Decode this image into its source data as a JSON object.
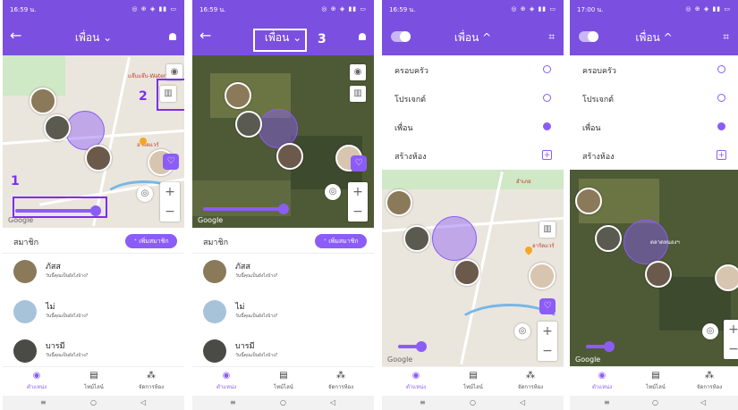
{
  "screens": [
    {
      "status_time": "16:59 น.",
      "status_icons": "◎ ⊕ ◈ ▮▮ ▭",
      "title": "เพื่อน ⌄",
      "members_header": "สมาชิก",
      "add_member_label": "⁺ เพิ่มสมาชิก",
      "google_label": "Google",
      "map_label_1": "แจ๊บแจ๊บ-Water",
      "map_label_2": "ฮาร์ดแวร์",
      "annotation_1": "1",
      "annotation_2": "2",
      "members": [
        {
          "name": "ภัสส",
          "sub": "วันนี้คุณเป็นยังไงบ้าง?"
        },
        {
          "name": "ไม่",
          "sub": "วันนี้คุณเป็นยังไงบ้าง?"
        },
        {
          "name": "บารมี",
          "sub": "วันนี้คุณเป็นยังไงบ้าง?"
        }
      ],
      "nav": [
        {
          "label": "ตำแหน่ง",
          "icon": "location-pin-icon",
          "active": true
        },
        {
          "label": "ไทม์ไลน์",
          "icon": "timeline-icon",
          "active": false
        },
        {
          "label": "จัดการห้อง",
          "icon": "group-icon",
          "active": false
        }
      ]
    },
    {
      "status_time": "16:59 น.",
      "status_icons": "◎ ⊕ ◈ ▮▮ ▭",
      "title": "เพื่อน ⌄",
      "members_header": "สมาชิก",
      "add_member_label": "⁺ เพิ่มสมาชิก",
      "google_label": "Google",
      "annotation_3": "3",
      "members": [
        {
          "name": "ภัสส",
          "sub": "วันนี้คุณเป็นยังไงบ้าง?"
        },
        {
          "name": "ไม่",
          "sub": "วันนี้คุณเป็นยังไงบ้าง?"
        },
        {
          "name": "บารมี",
          "sub": "วันนี้คุณเป็นยังไงบ้าง?"
        }
      ],
      "nav": [
        {
          "label": "ตำแหน่ง",
          "icon": "location-pin-icon",
          "active": true
        },
        {
          "label": "ไทม์ไลน์",
          "icon": "timeline-icon",
          "active": false
        },
        {
          "label": "จัดการห้อง",
          "icon": "group-icon",
          "active": false
        }
      ]
    },
    {
      "status_time": "16:59 น.",
      "status_icons": "◎ ⊕ ◈ ▮▮ ▭",
      "title": "เพื่อน ^",
      "google_label": "Google",
      "map_label_1": "ฮาร์ดแวร์",
      "map_label_2": "อำเภอ",
      "menu": [
        {
          "label": "ครอบครัว",
          "type": "radio",
          "selected": false
        },
        {
          "label": "โปรเจกต์",
          "type": "radio",
          "selected": false
        },
        {
          "label": "เพื่อน",
          "type": "radio",
          "selected": true
        },
        {
          "label": "สร้างห้อง",
          "type": "add",
          "selected": false
        }
      ],
      "nav": [
        {
          "label": "ตำแหน่ง",
          "icon": "location-pin-icon",
          "active": true
        },
        {
          "label": "ไทม์ไลน์",
          "icon": "timeline-icon",
          "active": false
        },
        {
          "label": "จัดการห้อง",
          "icon": "group-icon",
          "active": false
        }
      ]
    },
    {
      "status_time": "17:00 น.",
      "status_icons": "◎ ⊕ ◈ ▮▮ ▭",
      "title": "เพื่อน ^",
      "google_label": "Google",
      "map_label_1": "ตลาดหนองฯ",
      "menu": [
        {
          "label": "ครอบครัว",
          "type": "radio",
          "selected": false
        },
        {
          "label": "โปรเจกต์",
          "type": "radio",
          "selected": false
        },
        {
          "label": "เพื่อน",
          "type": "radio",
          "selected": true
        },
        {
          "label": "สร้างห้อง",
          "type": "add",
          "selected": false
        }
      ],
      "nav": [
        {
          "label": "ตำแหน่ง",
          "icon": "location-pin-icon",
          "active": true
        },
        {
          "label": "ไทม์ไลน์",
          "icon": "timeline-icon",
          "active": false
        },
        {
          "label": "จัดการห้อง",
          "icon": "group-icon",
          "active": false
        }
      ]
    }
  ],
  "system_nav": {
    "menu": "≡",
    "home": "○",
    "back": "◁"
  },
  "colors": {
    "accent": "#7b4fe0",
    "purple": "#8b5cf6",
    "annotation": "#7b2ff0"
  }
}
